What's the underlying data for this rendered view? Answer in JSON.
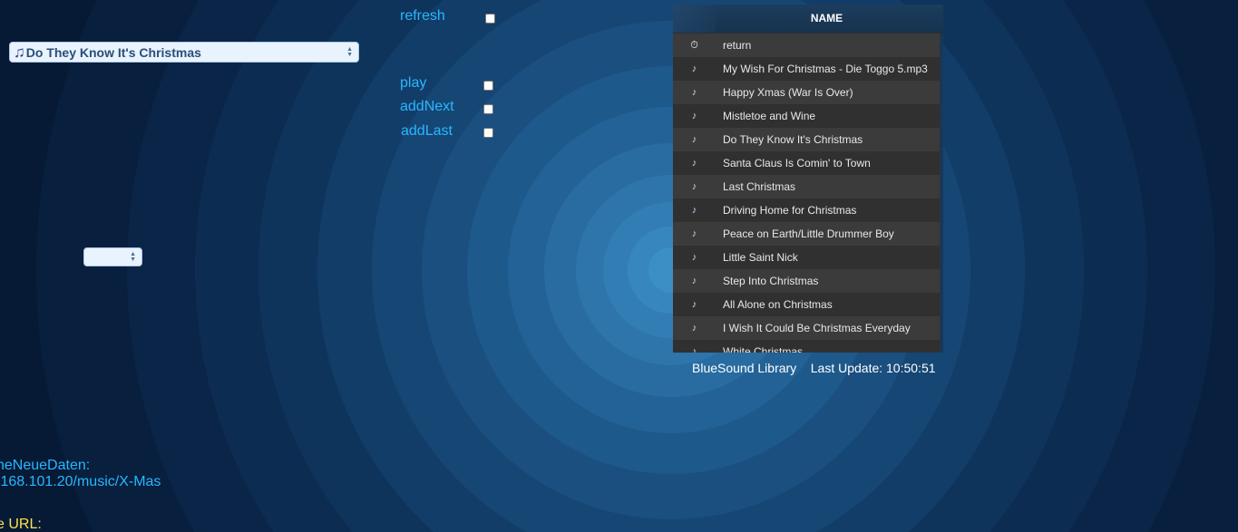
{
  "title_select": {
    "icon": "music-note-icon",
    "value": "Do They Know It's Christmas"
  },
  "controls": {
    "refresh": "refresh",
    "play": "play",
    "add_next": "addNext",
    "add_last": "addLast"
  },
  "library": {
    "header": "NAME",
    "rows": [
      {
        "icon": "stopwatch-icon",
        "label": "return"
      },
      {
        "icon": "music-note-icon",
        "label": "My Wish For Christmas - Die Toggo 5.mp3"
      },
      {
        "icon": "music-note-icon",
        "label": "Happy Xmas (War Is Over)"
      },
      {
        "icon": "music-note-icon",
        "label": "Mistletoe and Wine"
      },
      {
        "icon": "music-note-icon",
        "label": "Do They Know It's Christmas"
      },
      {
        "icon": "music-note-icon",
        "label": "Santa Claus Is Comin' to Town"
      },
      {
        "icon": "music-note-icon",
        "label": "Last Christmas"
      },
      {
        "icon": "music-note-icon",
        "label": "Driving Home for Christmas"
      },
      {
        "icon": "music-note-icon",
        "label": "Peace on Earth/Little Drummer Boy"
      },
      {
        "icon": "music-note-icon",
        "label": "Little Saint Nick"
      },
      {
        "icon": "music-note-icon",
        "label": "Step Into Christmas"
      },
      {
        "icon": "music-note-icon",
        "label": "All Alone on Christmas"
      },
      {
        "icon": "music-note-icon",
        "label": "I Wish It Could Be Christmas Everyday"
      },
      {
        "icon": "music-note-icon",
        "label": "White Christmas"
      }
    ],
    "footer_name": "BlueSound Library",
    "footer_update": "Last Update: 10:50:51"
  },
  "left_info": {
    "line1": "heNeueDaten:",
    "line2": ".168.101.20/music/X-Mas",
    "line3": "e URL:"
  }
}
